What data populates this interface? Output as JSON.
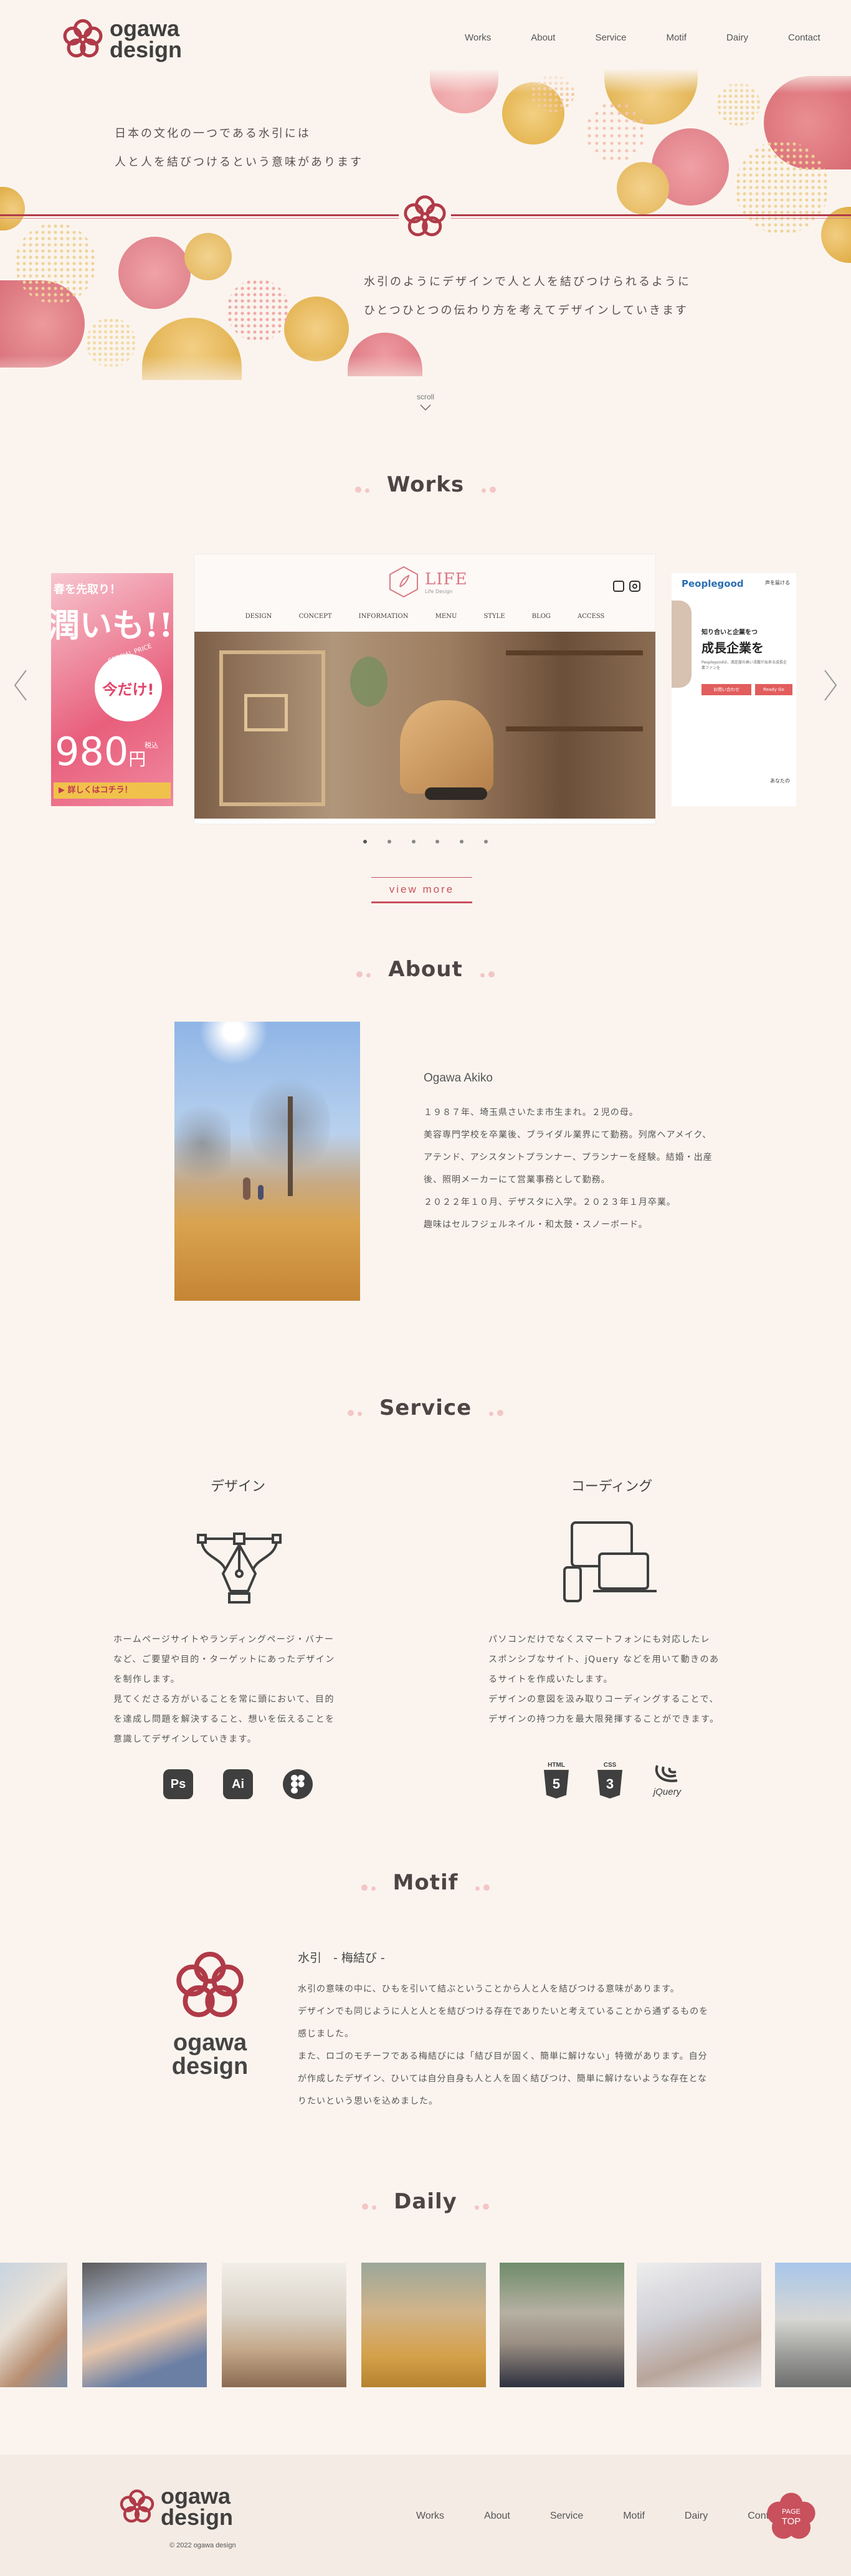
{
  "brand": {
    "line1": "ogawa",
    "line2": "design"
  },
  "nav": {
    "items": [
      {
        "label": "Works"
      },
      {
        "label": "About"
      },
      {
        "label": "Service"
      },
      {
        "label": "Motif"
      },
      {
        "label": "Dairy"
      },
      {
        "label": "Contact"
      }
    ]
  },
  "hero": {
    "copy_top": [
      "日本の文化の一つである水引には",
      "人と人を結びつけるという意味があります"
    ],
    "copy_bottom": [
      "水引のようにデザインで人と人を結びつけられるように",
      "ひとつひとつの伝わり方を考えてデザインしていきます"
    ],
    "scroll_label": "scroll"
  },
  "works": {
    "title": "Works",
    "view_more": "view more",
    "slide_count": 6,
    "active_slide": 0,
    "left_banner": {
      "line1": "春を先取り！",
      "line2": "潤いも!!",
      "badge": "今だけ!",
      "ribbon": "SPECIAL PRICE",
      "price": "980",
      "unit": "円",
      "tax": "税込",
      "cta": "▶ 詳しくはコチラ！"
    },
    "center_site": {
      "logo": "LIFE",
      "logo_sub": "Life Design",
      "menu": [
        "DESIGN",
        "CONCEPT",
        "INFORMATION",
        "MENU",
        "STYLE",
        "BLOG",
        "ACCESS"
      ]
    },
    "right_site": {
      "brand": "Peoplegood",
      "nav_text": "声を届ける",
      "headline1": "知り合いと企業をつ",
      "headline2": "成長企業を",
      "sub": "Peoplegoodは、満足度の高い活躍が出来る成長企業ファンを",
      "cta": "お問い合わせ",
      "cta2": "Ready Go",
      "bottom": "あなたの"
    }
  },
  "about": {
    "title": "About",
    "name": "Ogawa Akiko",
    "lines": [
      "１９８７年、埼玉県さいたま市生まれ。２児の母。",
      "美容専門学校を卒業後、ブライダル業界にて勤務。列席ヘアメイク、",
      "アテンド、アシスタントプランナー、プランナーを経験。結婚・出産",
      "後、照明メーカーにて営業事務として勤務。",
      "２０２２年１０月、デザスタに入学。２０２３年１月卒業。",
      "趣味はセルフジェルネイル・和太鼓・スノーボード。"
    ]
  },
  "service": {
    "title": "Service",
    "design": {
      "heading": "デザイン",
      "lines": [
        "ホームページサイトやランディングページ・バナー",
        "など、ご要望や目的・ターゲットにあったデザイン",
        "を制作します。",
        "見てくださる方がいることを常に頭において、目的",
        "を達成し問題を解決すること、想いを伝えることを",
        "意識してデザインしていきます。"
      ],
      "tools": [
        "Ps",
        "Ai",
        "Figma"
      ]
    },
    "coding": {
      "heading": "コーディング",
      "lines": [
        "パソコンだけでなくスマートフォンにも対応したレ",
        "スポンシブなサイト、jQuery などを用いて動きのあ",
        "るサイトを作成いたします。",
        "デザインの意図を汲み取りコーディングすることで、",
        "デザインの持つ力を最大限発揮することができます。"
      ],
      "tools": [
        "HTML",
        "CSS",
        "jQuery"
      ],
      "tool_numbers": [
        "5",
        "3"
      ]
    }
  },
  "motif": {
    "title": "Motif",
    "heading": "水引　- 梅結び -",
    "lines": [
      "水引の意味の中に、ひもを引いて結ぶということから人と人を結びつける意味があります。",
      "デザインでも同じように人と人とを結びつける存在でありたいと考えていることから通ずるものを",
      "感じました。",
      "また、ロゴのモチーフである梅結びには「結び目が固く、簡単に解けない」特徴があります。自分",
      "が作成したデザイン、ひいては自分自身も人と人を固く結びつけ、簡単に解けないような存在とな",
      "りたいという思いを込めました。"
    ],
    "logo_line1": "ogawa",
    "logo_line2": "design"
  },
  "daily": {
    "title": "Daily"
  },
  "footer": {
    "copyright": "© 2022 ogawa design",
    "nav": [
      "Works",
      "About",
      "Service",
      "Motif",
      "Dairy",
      "Contact"
    ],
    "page_top": {
      "line1": "PAGE",
      "line2": "TOP"
    }
  },
  "colors": {
    "accent": "#b03a48",
    "text": "#4a4a4a",
    "background": "#fbf4ee",
    "button_border": "#c9505d"
  },
  "icons": [
    "ume-knot-icon",
    "chevron-down-icon",
    "arrow-left-icon",
    "arrow-right-icon",
    "pen-tool-icon",
    "devices-icon",
    "instagram-icon"
  ]
}
